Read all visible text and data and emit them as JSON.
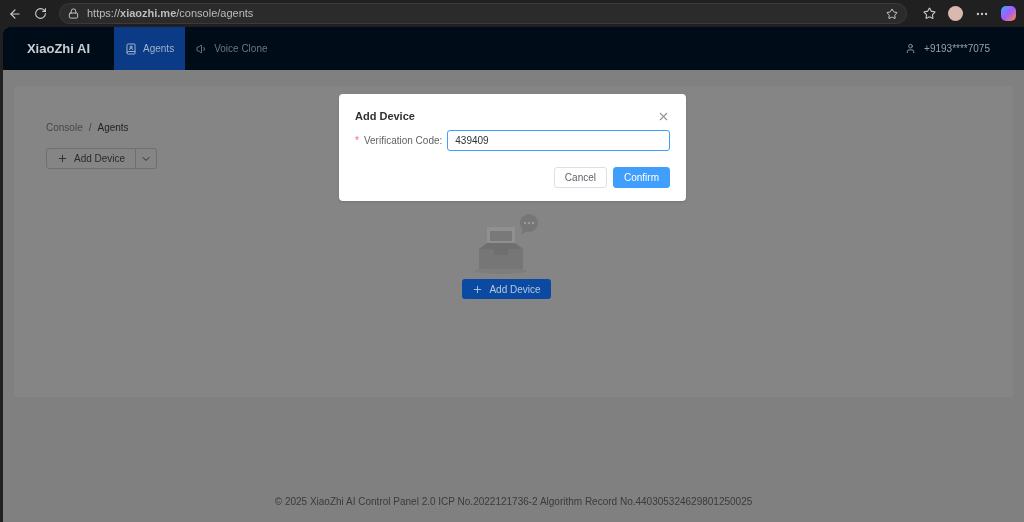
{
  "browser": {
    "url": "https://**xiaozhi.me**/console/agents"
  },
  "header": {
    "brand": "XiaoZhi AI",
    "nav": [
      {
        "label": "Agents",
        "kind": "agents",
        "selected": true
      },
      {
        "label": "Voice Clone",
        "kind": "voice",
        "selected": false
      }
    ],
    "user": "+9193****7075"
  },
  "breadcrumb": {
    "separator": "/",
    "items": [
      "Console",
      "Agents"
    ]
  },
  "toolbar": {
    "button": "Add Device"
  },
  "empty_state": {
    "button": "Add Device"
  },
  "footer": "© 2025 XiaoZhi AI Control Panel 2.0 ICP No.2022121736-2 Algorithm Record No.440305324629801250025",
  "dialog": {
    "title": "Add Device",
    "field": {
      "label": "Verification Code:",
      "required_mark": "*",
      "value": "439409"
    },
    "buttons": [
      {
        "label": "Cancel",
        "kind": "secondary"
      },
      {
        "label": "Confirm",
        "kind": "primary"
      }
    ]
  }
}
